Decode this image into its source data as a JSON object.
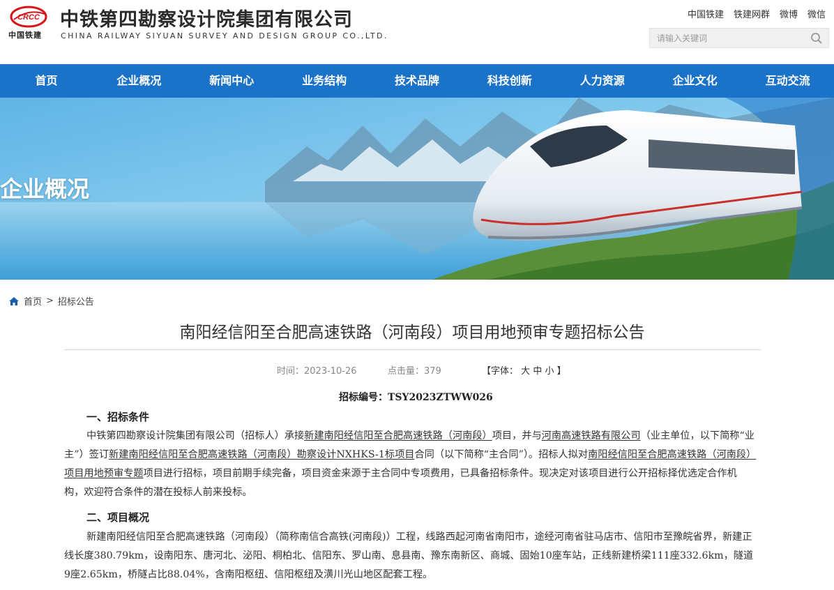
{
  "header": {
    "logo_text": "CRCC",
    "logo_caption": "中国铁建",
    "org_name_cn": "中铁第四勘察设计院集团有限公司",
    "org_name_en": "CHINA RAILWAY SIYUAN SURVEY AND DESIGN GROUP CO.,LTD.",
    "top_links": [
      "中国铁建",
      "铁建网群",
      "微博",
      "微信"
    ],
    "search_placeholder": "请输入关键词"
  },
  "nav": {
    "items": [
      "首页",
      "企业概况",
      "新闻中心",
      "业务结构",
      "技术品牌",
      "科技创新",
      "人力资源",
      "企业文化",
      "互动交流"
    ]
  },
  "banner": {
    "title": "企业概况"
  },
  "breadcrumb": {
    "home": "首页",
    "separator": ">",
    "current": "招标公告"
  },
  "article": {
    "title": "南阳经信阳至合肥高速铁路（河南段）项目用地预审专题招标公告",
    "time": "时间：2023-10-26",
    "views": "点击量：379",
    "font_label": "【字体：",
    "font_large": "大",
    "font_medium": "中",
    "font_small": "小",
    "font_close": "】",
    "bid_number": "招标编号：TSY2023ZTWW026",
    "section1_heading": "一、招标条件",
    "p1": {
      "t1": "中铁第四勘察设计院集团有限公司（招标人）承接",
      "u1": "新建南阳经信阳至合肥高速铁路（河南段）",
      "t2": "项目，并与",
      "u2": "河南高速铁路有限公司",
      "t3": "（业主单位，以下简称“业主”）签订",
      "u3": "新建南阳经信阳至合肥高速铁路（河南段）勘察设计NXHKS-1标项目",
      "t4": "合同（以下简称“主合同”）。招标人拟对",
      "u4": "南阳经信阳至合肥高速铁路（河南段）项目用地预审专题",
      "t5": "项目进行招标，项目前期手续完备，项目资金来源于主合同中专项费用，已具备招标条件。现决定对该项目进行公开招标择优选定合作机构，欢迎符合条件的潜在投标人前来投标。"
    },
    "section2_heading": "二、项目概况",
    "p2": "新建南阳经信阳至合肥高速铁路（河南段）（简称南信合高铁(河南段)）工程，线路西起河南省南阳市，途经河南省驻马店市、信阳市至豫皖省界，新建正线长度380.79km，设南阳东、唐河北、泌阳、桐柏北、信阳东、罗山南、息县南、豫东南新区、商城、固始10座车站，正线新建桥梁111座332.6km，隧道9座2.65km，桥隧占比88.04%，含南阳枢纽、信阳枢纽及潢川光山地区配套工程。"
  },
  "colors": {
    "nav_bg": "#1a73c8",
    "logo_red": "#d7141a",
    "text": "#333333"
  }
}
